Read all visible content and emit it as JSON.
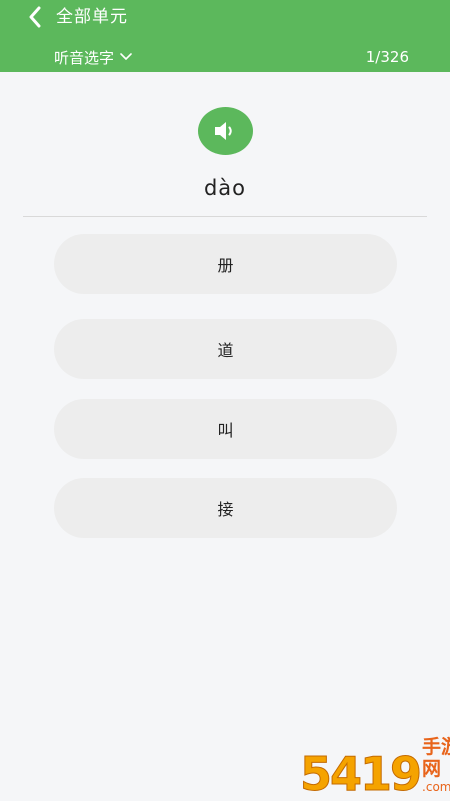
{
  "header": {
    "title": "全部单元",
    "mode": "听音选字",
    "progress": "1/326",
    "background_color": "#5cb85c"
  },
  "question": {
    "pinyin": "dào",
    "speaker_icon": "speaker-icon"
  },
  "options": [
    {
      "label": "册"
    },
    {
      "label": "道"
    },
    {
      "label": "叫"
    },
    {
      "label": "接"
    }
  ],
  "watermark": {
    "number": "5419",
    "text": "手游网",
    "url": ".com.cn"
  }
}
